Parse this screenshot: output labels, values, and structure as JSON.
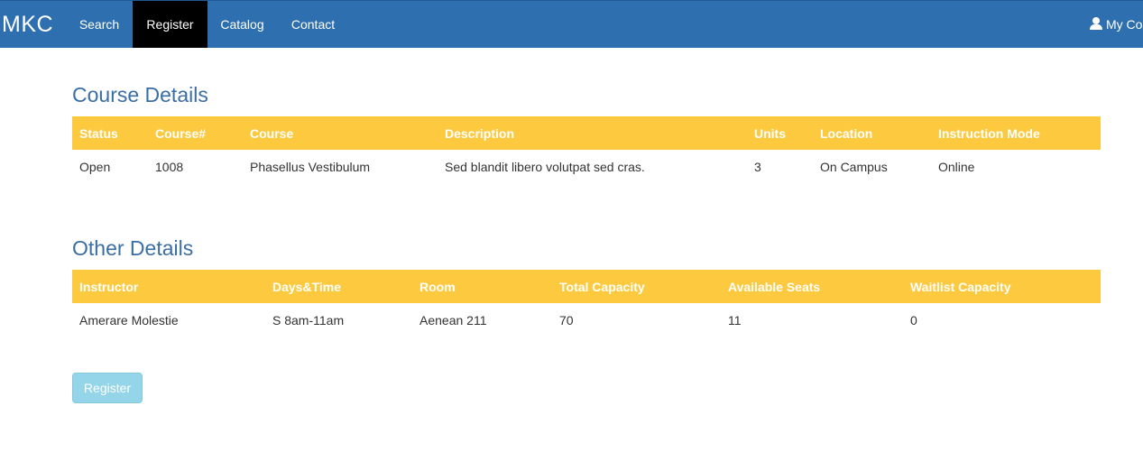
{
  "nav": {
    "brand": "MKC",
    "items": [
      {
        "label": "Search",
        "active": false
      },
      {
        "label": "Register",
        "active": true
      },
      {
        "label": "Catalog",
        "active": false
      },
      {
        "label": "Contact",
        "active": false
      }
    ],
    "account_label": "My Co",
    "account_icon": "user-icon",
    "bar_color": "#2e6faf",
    "active_color": "#000000"
  },
  "course_details": {
    "title": "Course Details",
    "columns": [
      "Status",
      "Course#",
      "Course",
      "Description",
      "Units",
      "Location",
      "Instruction Mode"
    ],
    "row": [
      "Open",
      "1008",
      "Phasellus Vestibulum",
      "Sed blandit libero volutpat sed cras.",
      "3",
      "On Campus",
      "Online"
    ]
  },
  "other_details": {
    "title": "Other Details",
    "columns": [
      "Instructor",
      "Days&Time",
      "Room",
      "Total Capacity",
      "Available Seats",
      "Waitlist Capacity"
    ],
    "row": [
      "Amerare Molestie",
      "S 8am-11am",
      "Aenean 211",
      "70",
      "11",
      "0"
    ]
  },
  "actions": {
    "register_label": "Register"
  },
  "colors": {
    "header_row": "#fdc93e",
    "section_title": "#3a6ea5",
    "button": "#94d5ea"
  }
}
